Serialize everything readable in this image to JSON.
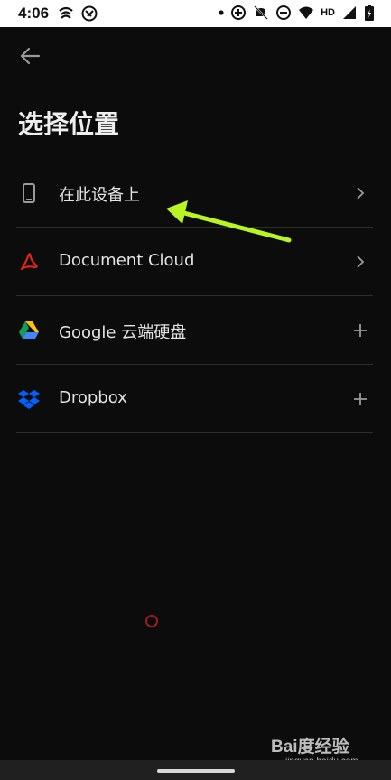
{
  "status_bar": {
    "time": "4:06",
    "network_label": "HD",
    "icons": [
      "signal-wave-icon",
      "at-sign-icon",
      "dot-icon",
      "data-saver-icon",
      "mute-icon",
      "do-not-disturb-icon",
      "wifi-icon",
      "cell-signal-icon",
      "battery-icon"
    ]
  },
  "header": {
    "back_icon": "arrow-left-icon",
    "title": "选择位置"
  },
  "locations": [
    {
      "label": "在此设备上",
      "icon": "phone-icon",
      "action": "chevron-right"
    },
    {
      "label": "Document Cloud",
      "icon": "adobe-acrobat-icon",
      "action": "chevron-right"
    },
    {
      "label": "Google 云端硬盘",
      "icon": "google-drive-icon",
      "action": "plus"
    },
    {
      "label": "Dropbox",
      "icon": "dropbox-icon",
      "action": "plus"
    }
  ],
  "annotation": {
    "arrow_color": "#b8f523",
    "touch_color": "#9a1e1e"
  },
  "watermark": {
    "main": "Bai度经验",
    "sub": "jingyan.baidu.com"
  },
  "colors": {
    "background": "#0c0c0c",
    "separator": "#2e2e2e",
    "text": "#e4e4e4",
    "acrobat_red": "#e1251b",
    "dropbox_blue": "#0061ff"
  }
}
